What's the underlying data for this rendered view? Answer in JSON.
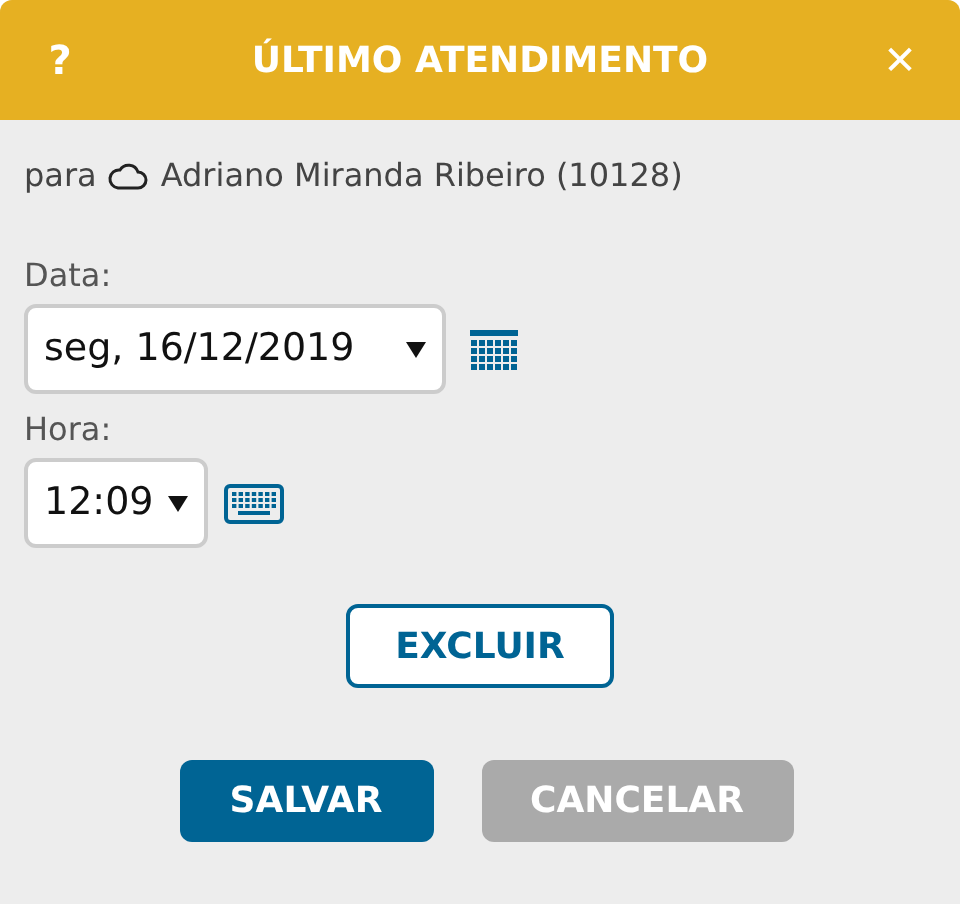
{
  "window": {
    "title": "ÚLTIMO ATENDIMENTO",
    "help": "?",
    "close": "✕"
  },
  "recipient": {
    "prefix": "para",
    "name": "Adriano Miranda Ribeiro (10128)"
  },
  "fields": [
    {
      "label": "Data:",
      "value": "seg, 16/12/2019",
      "kind": "date"
    },
    {
      "label": "Hora:",
      "value": "12:09",
      "kind": "time"
    }
  ],
  "buttons": [
    {
      "label": "EXCLUIR",
      "kind": "outline"
    },
    {
      "label": "SALVAR",
      "kind": "primary"
    },
    {
      "label": "CANCELAR",
      "kind": "secondary"
    }
  ]
}
